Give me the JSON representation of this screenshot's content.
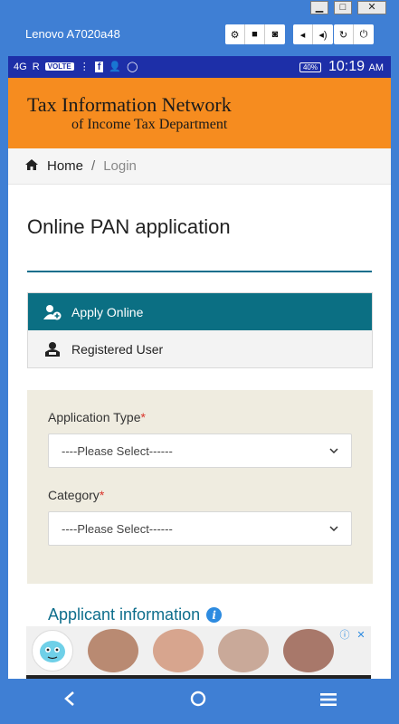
{
  "window": {
    "minimize": "▁",
    "maximize": "□",
    "close": "✕"
  },
  "emulator": {
    "title": "Lenovo A7020a48",
    "tools": [
      "gear-icon",
      "video-icon",
      "camera-icon",
      "volume-down-icon",
      "volume-up-icon",
      "rotate-icon",
      "power-icon"
    ]
  },
  "statusbar": {
    "network1": "4G",
    "network2": "R",
    "volte": "VOLTE",
    "battery": "40%",
    "time": "10:19",
    "ampm": "AM"
  },
  "header": {
    "title": "Tax Information Network",
    "subtitle": "of Income Tax Department",
    "bg": "#f68c1f"
  },
  "breadcrumb": {
    "home": "Home",
    "separator": "/",
    "current": "Login"
  },
  "page": {
    "title": "Online PAN application"
  },
  "menu": {
    "items": [
      {
        "label": "Apply Online",
        "icon": "add-user-icon",
        "active": true
      },
      {
        "label": "Registered User",
        "icon": "user-group-icon",
        "active": false
      }
    ],
    "accent": "#0b6f83"
  },
  "form": {
    "application_type": {
      "label": "Application Type",
      "required": "*",
      "value": "----Please Select------"
    },
    "category": {
      "label": "Category",
      "required": "*",
      "value": "----Please Select------"
    }
  },
  "applicant": {
    "heading": "Applicant information",
    "info": "i"
  },
  "ad": {
    "info": "ⓘ",
    "close": "✕"
  },
  "navbar": {
    "back": "back-icon",
    "home": "home-icon",
    "menu": "menu-icon"
  }
}
